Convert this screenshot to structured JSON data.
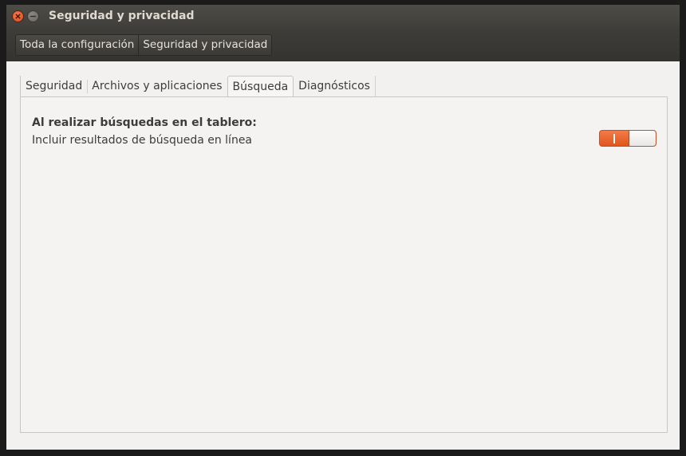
{
  "window": {
    "title": "Seguridad y privacidad",
    "controls": [
      "close-icon",
      "minimize-icon"
    ],
    "accent_color": "#e95420"
  },
  "breadcrumb": {
    "items": [
      {
        "label": "Toda la configuración"
      },
      {
        "label": "Seguridad y privacidad"
      }
    ]
  },
  "tabs": [
    {
      "label": "Seguridad",
      "active": false
    },
    {
      "label": "Archivos y aplicaciones",
      "active": false
    },
    {
      "label": "Búsqueda",
      "active": true
    },
    {
      "label": "Diagnósticos",
      "active": false
    }
  ],
  "search_panel": {
    "heading": "Al realizar búsquedas en el tablero:",
    "option_label": "Incluir resultados de búsqueda en línea",
    "toggle_on": true
  }
}
